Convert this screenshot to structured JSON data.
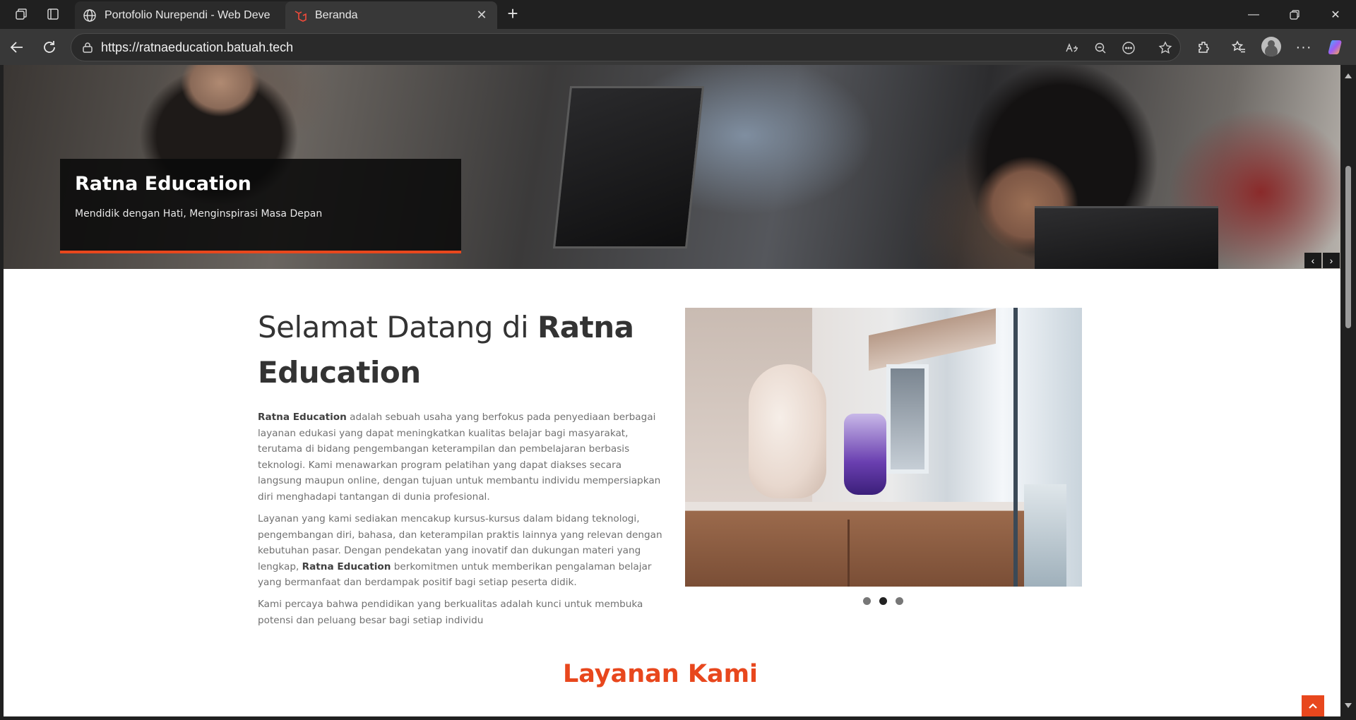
{
  "tabs": [
    {
      "title": "Portofolio Nurependi - Web Deve",
      "favicon": "globe-icon",
      "active": false
    },
    {
      "title": "Beranda",
      "favicon": "laravel-icon",
      "active": true
    }
  ],
  "address_bar": {
    "url": "https://ratnaeducation.batuah.tech"
  },
  "hero": {
    "title": "Ratna Education",
    "subtitle": "Mendidik dengan Hati, Menginspirasi Masa Depan"
  },
  "welcome": {
    "title_light": "Selamat Datang di ",
    "title_bold": "Ratna Education",
    "p1_bold": "Ratna Education",
    "p1_rest": " adalah sebuah usaha yang berfokus pada penyediaan berbagai layanan edukasi yang dapat meningkatkan kualitas belajar bagi masyarakat, terutama di bidang pengembangan keterampilan dan pembelajaran berbasis teknologi. Kami menawarkan program pelatihan yang dapat diakses secara langsung maupun online, dengan tujuan untuk membantu individu mempersiapkan diri menghadapi tantangan di dunia profesional.",
    "p2_start": "Layanan yang kami sediakan mencakup kursus-kursus dalam bidang teknologi, pengembangan diri, bahasa, dan keterampilan praktis lainnya yang relevan dengan kebutuhan pasar. Dengan pendekatan yang inovatif dan dukungan materi yang lengkap, ",
    "p2_bold": "Ratna Education",
    "p2_rest": " berkomitmen untuk memberikan pengalaman belajar yang bermanfaat dan berdampak positif bagi setiap peserta didik.",
    "p3": "Kami percaya bahwa pendidikan yang berkualitas adalah kunci untuk membuka potensi dan peluang besar bagi setiap individu"
  },
  "carousel": {
    "slide_count": 3,
    "active_index": 1
  },
  "services": {
    "title": "Layanan Kami"
  },
  "colors": {
    "accent": "#e8471d",
    "browser_bg": "#202020"
  }
}
